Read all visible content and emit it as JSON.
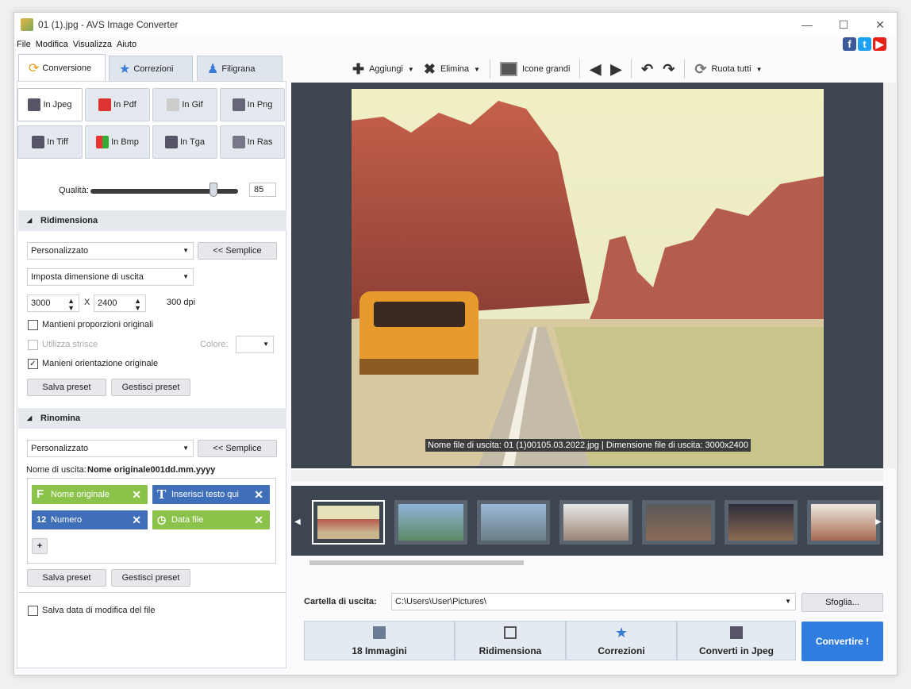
{
  "window": {
    "title": "01 (1).jpg - AVS Image Converter"
  },
  "menu": [
    "File",
    "Modifica",
    "Visualizza",
    "Aiuto"
  ],
  "tabs": [
    {
      "label": "Conversione"
    },
    {
      "label": "Correzioni"
    },
    {
      "label": "Filigrana"
    }
  ],
  "formats": [
    "In Jpeg",
    "In Pdf",
    "In Gif",
    "In Png",
    "In Tiff",
    "In Bmp",
    "In Tga",
    "In Ras"
  ],
  "quality": {
    "label": "Qualità:",
    "value": "85",
    "level": 0.85
  },
  "resize": {
    "title": "Ridimensiona",
    "preset": "Personalizzato",
    "simple_btn": "<< Semplice",
    "mode": "Imposta dimensione di uscita",
    "width": "3000",
    "x": "X",
    "height": "2400",
    "dpi": "300 dpi",
    "keep_proportions": "Mantieni proporzioni originali",
    "use_stripes": "Utilizza strisce",
    "color_label": "Colore:",
    "keep_orientation": "Manieni orientazione originale",
    "save_preset": "Salva preset",
    "manage_preset": "Gestisci preset"
  },
  "rename": {
    "title": "Rinomina",
    "preset": "Personalizzato",
    "simple_btn": "<< Semplice",
    "output_name_label": "Nome di uscita:",
    "output_name_value": "Nome originale001dd.mm.yyyy",
    "chips": [
      "Nome originale",
      "Inserisci testo qui",
      "Numero",
      "Data file"
    ],
    "add": "+",
    "save_preset": "Salva preset",
    "manage_preset": "Gestisci preset"
  },
  "save_date": "Salva data di modifica del file",
  "toolbar": {
    "add": "Aggiungi",
    "delete": "Elimina",
    "view": "Icone grandi",
    "rotate_all": "Ruota tutti"
  },
  "preview": {
    "caption": "Nome file di uscita: 01 (1)00105.03.2022.jpg | Dimensione file di uscita: 3000x2400"
  },
  "output": {
    "label": "Cartella di uscita:",
    "path": "C:\\Users\\User\\Pictures\\",
    "browse": "Sfoglia..."
  },
  "steps": [
    {
      "label": "18 Immagini"
    },
    {
      "label": "Ridimensiona"
    },
    {
      "label": "Correzioni"
    },
    {
      "label": "Converti in Jpeg"
    }
  ],
  "convert": "Convertire !",
  "colors": {
    "accent": "#2f7de1",
    "chip_green": "#8bc34a",
    "chip_blue": "#3f6fb8"
  }
}
